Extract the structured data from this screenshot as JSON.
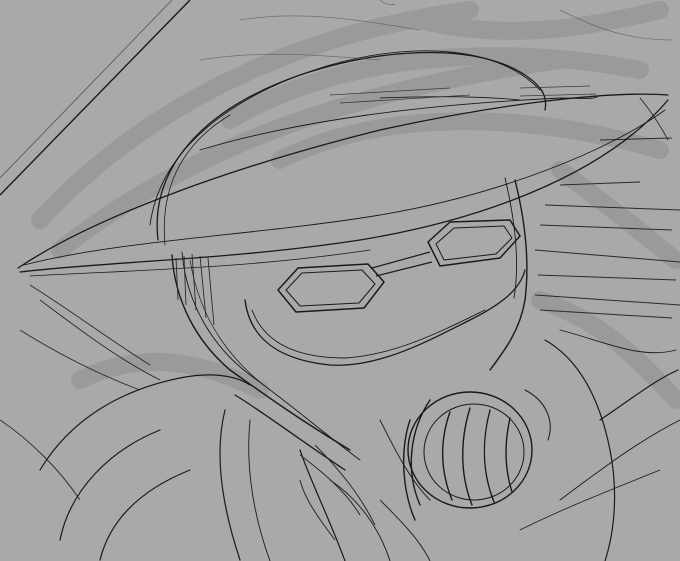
{
  "image": {
    "subject": "pencil-sketch-figure-wide-brim-hat-gas-mask",
    "palette": {
      "paper": "#a9a9a9",
      "shadow": "#8f8f8f",
      "ink": "#1a1a1a",
      "ink_light": "#3a3a3a"
    }
  }
}
